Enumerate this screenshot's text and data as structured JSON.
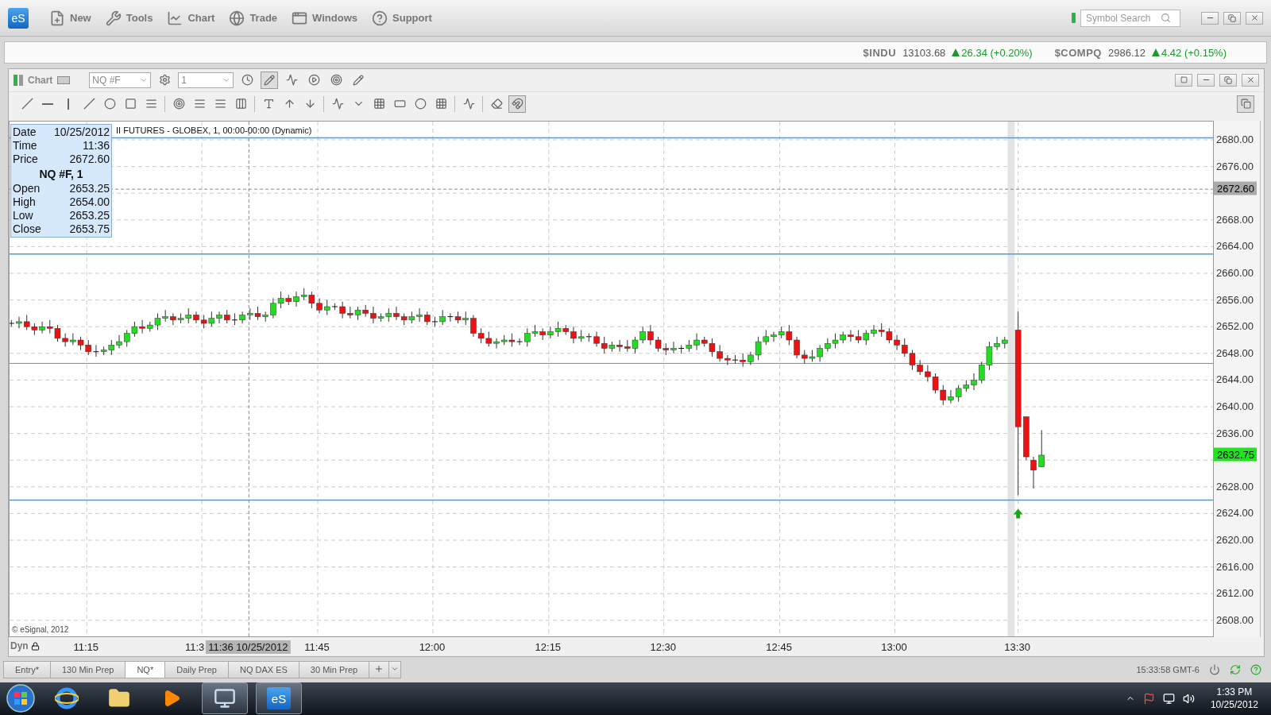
{
  "app": {
    "logo": "eS",
    "menu": [
      {
        "label": "New"
      },
      {
        "label": "Tools"
      },
      {
        "label": "Chart"
      },
      {
        "label": "Trade"
      },
      {
        "label": "Windows"
      },
      {
        "label": "Support"
      }
    ],
    "search": {
      "placeholder": "Symbol Search"
    }
  },
  "tickers": [
    {
      "symbol": "$INDU",
      "last": "13103.68",
      "change": "26.34 (+0.20%)"
    },
    {
      "symbol": "$COMPQ",
      "last": "2986.12",
      "change": "4.42 (+0.15%)"
    }
  ],
  "chart_window": {
    "title": "Chart",
    "symbol": "NQ #F",
    "interval": "1",
    "chart": {
      "title": "II FUTURES - GLOBEX, 1, 00:00-00:00 (Dynamic)",
      "data_window": {
        "top": [
          {
            "label": "Date",
            "value": "10/25/2012"
          },
          {
            "label": "Time",
            "value": "11:36"
          },
          {
            "label": "Price",
            "value": "2672.60"
          }
        ],
        "heading": "NQ #F, 1",
        "bottom": [
          {
            "label": "Open",
            "value": "2653.25"
          },
          {
            "label": "High",
            "value": "2654.00"
          },
          {
            "label": "Low",
            "value": "2653.25"
          },
          {
            "label": "Close",
            "value": "2653.75"
          }
        ]
      },
      "price_ticks": [
        "2680.00",
        "2676.00",
        "2668.00",
        "2664.00",
        "2660.00",
        "2656.00",
        "2652.00",
        "2648.00",
        "2644.00",
        "2640.00",
        "2636.00",
        "2628.00",
        "2624.00",
        "2620.00",
        "2616.00",
        "2612.00",
        "2608.00"
      ],
      "price_tags": [
        {
          "kind": "cursor",
          "value": "2672.60"
        },
        {
          "kind": "last",
          "value": "2632.75"
        }
      ],
      "copyright": "© eSignal, 2012",
      "mode": "Dyn",
      "time_labels": [
        "11:15",
        "11:3",
        "11:45",
        "12:00",
        "12:15",
        "12:30",
        "12:45",
        "13:00",
        "13:30"
      ],
      "cursor_time": "11:36 10/25/2012"
    }
  },
  "tabs": [
    {
      "label": "Entry*",
      "selected": false
    },
    {
      "label": "130 Min Prep",
      "selected": false
    },
    {
      "label": "NQ*",
      "selected": true
    },
    {
      "label": "Daily Prep",
      "selected": false
    },
    {
      "label": "NQ DAX ES",
      "selected": false
    },
    {
      "label": "30 Min Prep",
      "selected": false
    }
  ],
  "status": {
    "clock": "15:33:58 GMT-6"
  },
  "taskbar": {
    "app_label": "eS",
    "time": "1:33 PM",
    "date": "10/25/2012"
  }
}
